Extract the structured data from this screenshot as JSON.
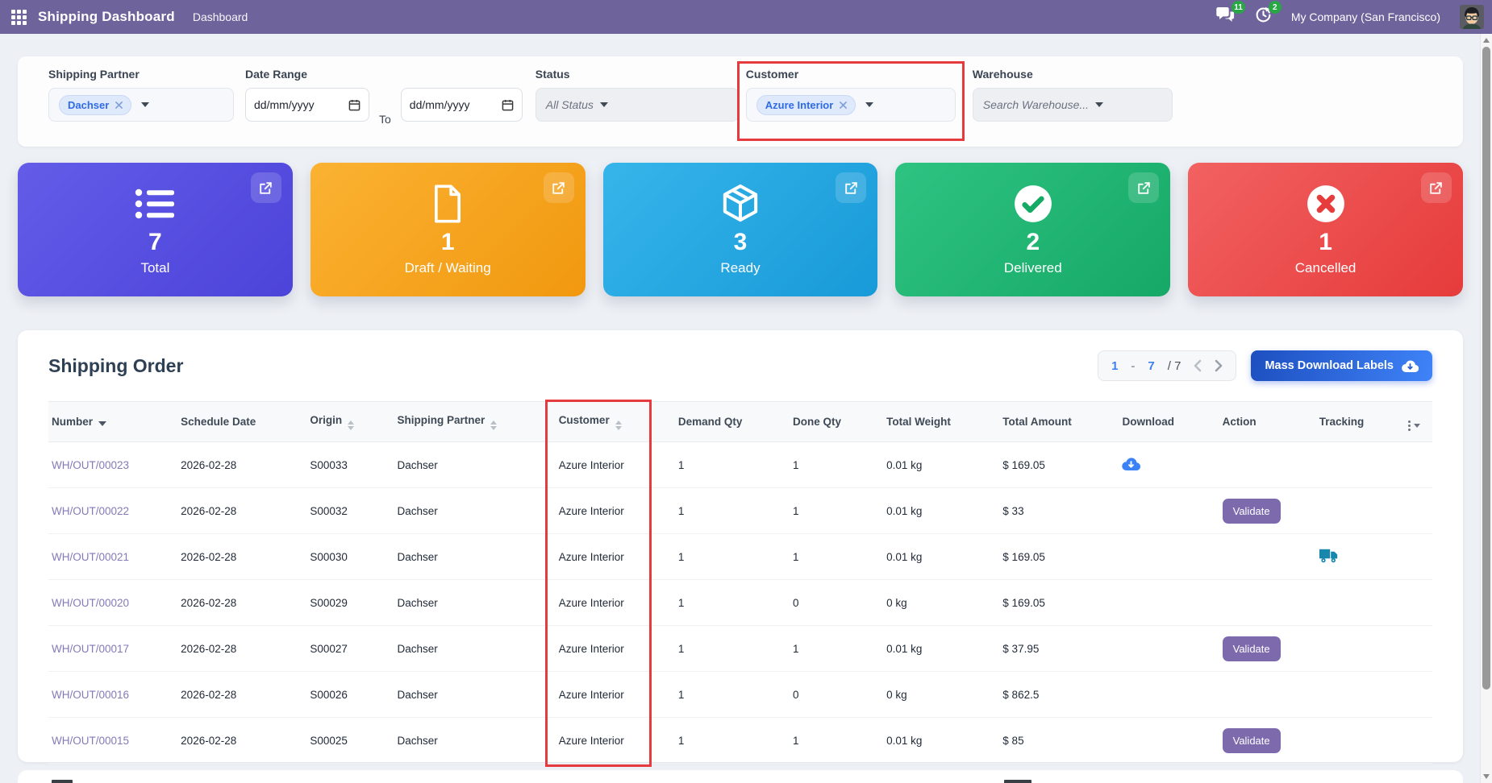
{
  "topbar": {
    "app_title": "Shipping Dashboard",
    "menu": "Dashboard",
    "messages_badge": "11",
    "activities_badge": "2",
    "company": "My Company (San Francisco)"
  },
  "filters": {
    "shipping_partner": {
      "label": "Shipping Partner",
      "chip": "Dachser"
    },
    "date_range": {
      "label": "Date Range",
      "from_placeholder": "dd/mm/yyyy",
      "to_label": "To",
      "to_placeholder": "dd/mm/yyyy"
    },
    "status": {
      "label": "Status",
      "value": "All Status"
    },
    "customer": {
      "label": "Customer",
      "chip": "Azure Interior"
    },
    "warehouse": {
      "label": "Warehouse",
      "placeholder": "Search Warehouse..."
    }
  },
  "cards": [
    {
      "label": "Total",
      "value": "7",
      "icon": "list-icon",
      "gradient": [
        "#635ce8",
        "#4c43d9"
      ]
    },
    {
      "label": "Draft / Waiting",
      "value": "1",
      "icon": "file-icon",
      "gradient": [
        "#fbb232",
        "#f1980f"
      ]
    },
    {
      "label": "Ready",
      "value": "3",
      "icon": "cube-icon",
      "gradient": [
        "#36b5ea",
        "#189ad8"
      ]
    },
    {
      "label": "Delivered",
      "value": "2",
      "icon": "check-circle-icon",
      "gradient": [
        "#2fc382",
        "#15a866"
      ]
    },
    {
      "label": "Cancelled",
      "value": "1",
      "icon": "x-circle-icon",
      "gradient": [
        "#f26161",
        "#e63b3b"
      ]
    }
  ],
  "orders": {
    "title": "Shipping Order",
    "pagination": {
      "start": "1",
      "dash": "-",
      "end": "7",
      "total": "/ 7"
    },
    "mass_download_label": "Mass Download Labels",
    "columns": [
      "Number",
      "Schedule Date",
      "Origin",
      "Shipping Partner",
      "Customer",
      "Demand Qty",
      "Done Qty",
      "Total Weight",
      "Total Amount",
      "Download",
      "Action",
      "Tracking"
    ],
    "rows": [
      {
        "number": "WH/OUT/00023",
        "schedule_date": "2026-02-28",
        "origin": "S00033",
        "partner": "Dachser",
        "customer": "Azure Interior",
        "demand_qty": "1",
        "done_qty": "1",
        "total_weight": "0.01 kg",
        "total_amount": "$ 169.05",
        "download": true,
        "action": "",
        "tracking": false
      },
      {
        "number": "WH/OUT/00022",
        "schedule_date": "2026-02-28",
        "origin": "S00032",
        "partner": "Dachser",
        "customer": "Azure Interior",
        "demand_qty": "1",
        "done_qty": "1",
        "total_weight": "0.01 kg",
        "total_amount": "$ 33",
        "download": false,
        "action": "Validate",
        "tracking": false
      },
      {
        "number": "WH/OUT/00021",
        "schedule_date": "2026-02-28",
        "origin": "S00030",
        "partner": "Dachser",
        "customer": "Azure Interior",
        "demand_qty": "1",
        "done_qty": "1",
        "total_weight": "0.01 kg",
        "total_amount": "$ 169.05",
        "download": false,
        "action": "",
        "tracking": true
      },
      {
        "number": "WH/OUT/00020",
        "schedule_date": "2026-02-28",
        "origin": "S00029",
        "partner": "Dachser",
        "customer": "Azure Interior",
        "demand_qty": "1",
        "done_qty": "0",
        "total_weight": "0 kg",
        "total_amount": "$ 169.05",
        "download": false,
        "action": "",
        "tracking": false
      },
      {
        "number": "WH/OUT/00017",
        "schedule_date": "2026-02-28",
        "origin": "S00027",
        "partner": "Dachser",
        "customer": "Azure Interior",
        "demand_qty": "1",
        "done_qty": "1",
        "total_weight": "0.01 kg",
        "total_amount": "$ 37.95",
        "download": false,
        "action": "Validate",
        "tracking": false
      },
      {
        "number": "WH/OUT/00016",
        "schedule_date": "2026-02-28",
        "origin": "S00026",
        "partner": "Dachser",
        "customer": "Azure Interior",
        "demand_qty": "1",
        "done_qty": "0",
        "total_weight": "0 kg",
        "total_amount": "$ 862.5",
        "download": false,
        "action": "",
        "tracking": false
      },
      {
        "number": "WH/OUT/00015",
        "schedule_date": "2026-02-28",
        "origin": "S00025",
        "partner": "Dachser",
        "customer": "Azure Interior",
        "demand_qty": "1",
        "done_qty": "1",
        "total_weight": "0.01 kg",
        "total_amount": "$ 85",
        "download": false,
        "action": "Validate",
        "tracking": false
      }
    ]
  },
  "colors": {
    "topbar_purple": "#6e639b",
    "accent_blue": "#3b82f6",
    "annotation_red": "#e63b3e",
    "validate_purple": "#7d6aad",
    "link_purple": "#847ab8",
    "badge_green": "#28a745",
    "tracking_teal": "#1787ad"
  }
}
